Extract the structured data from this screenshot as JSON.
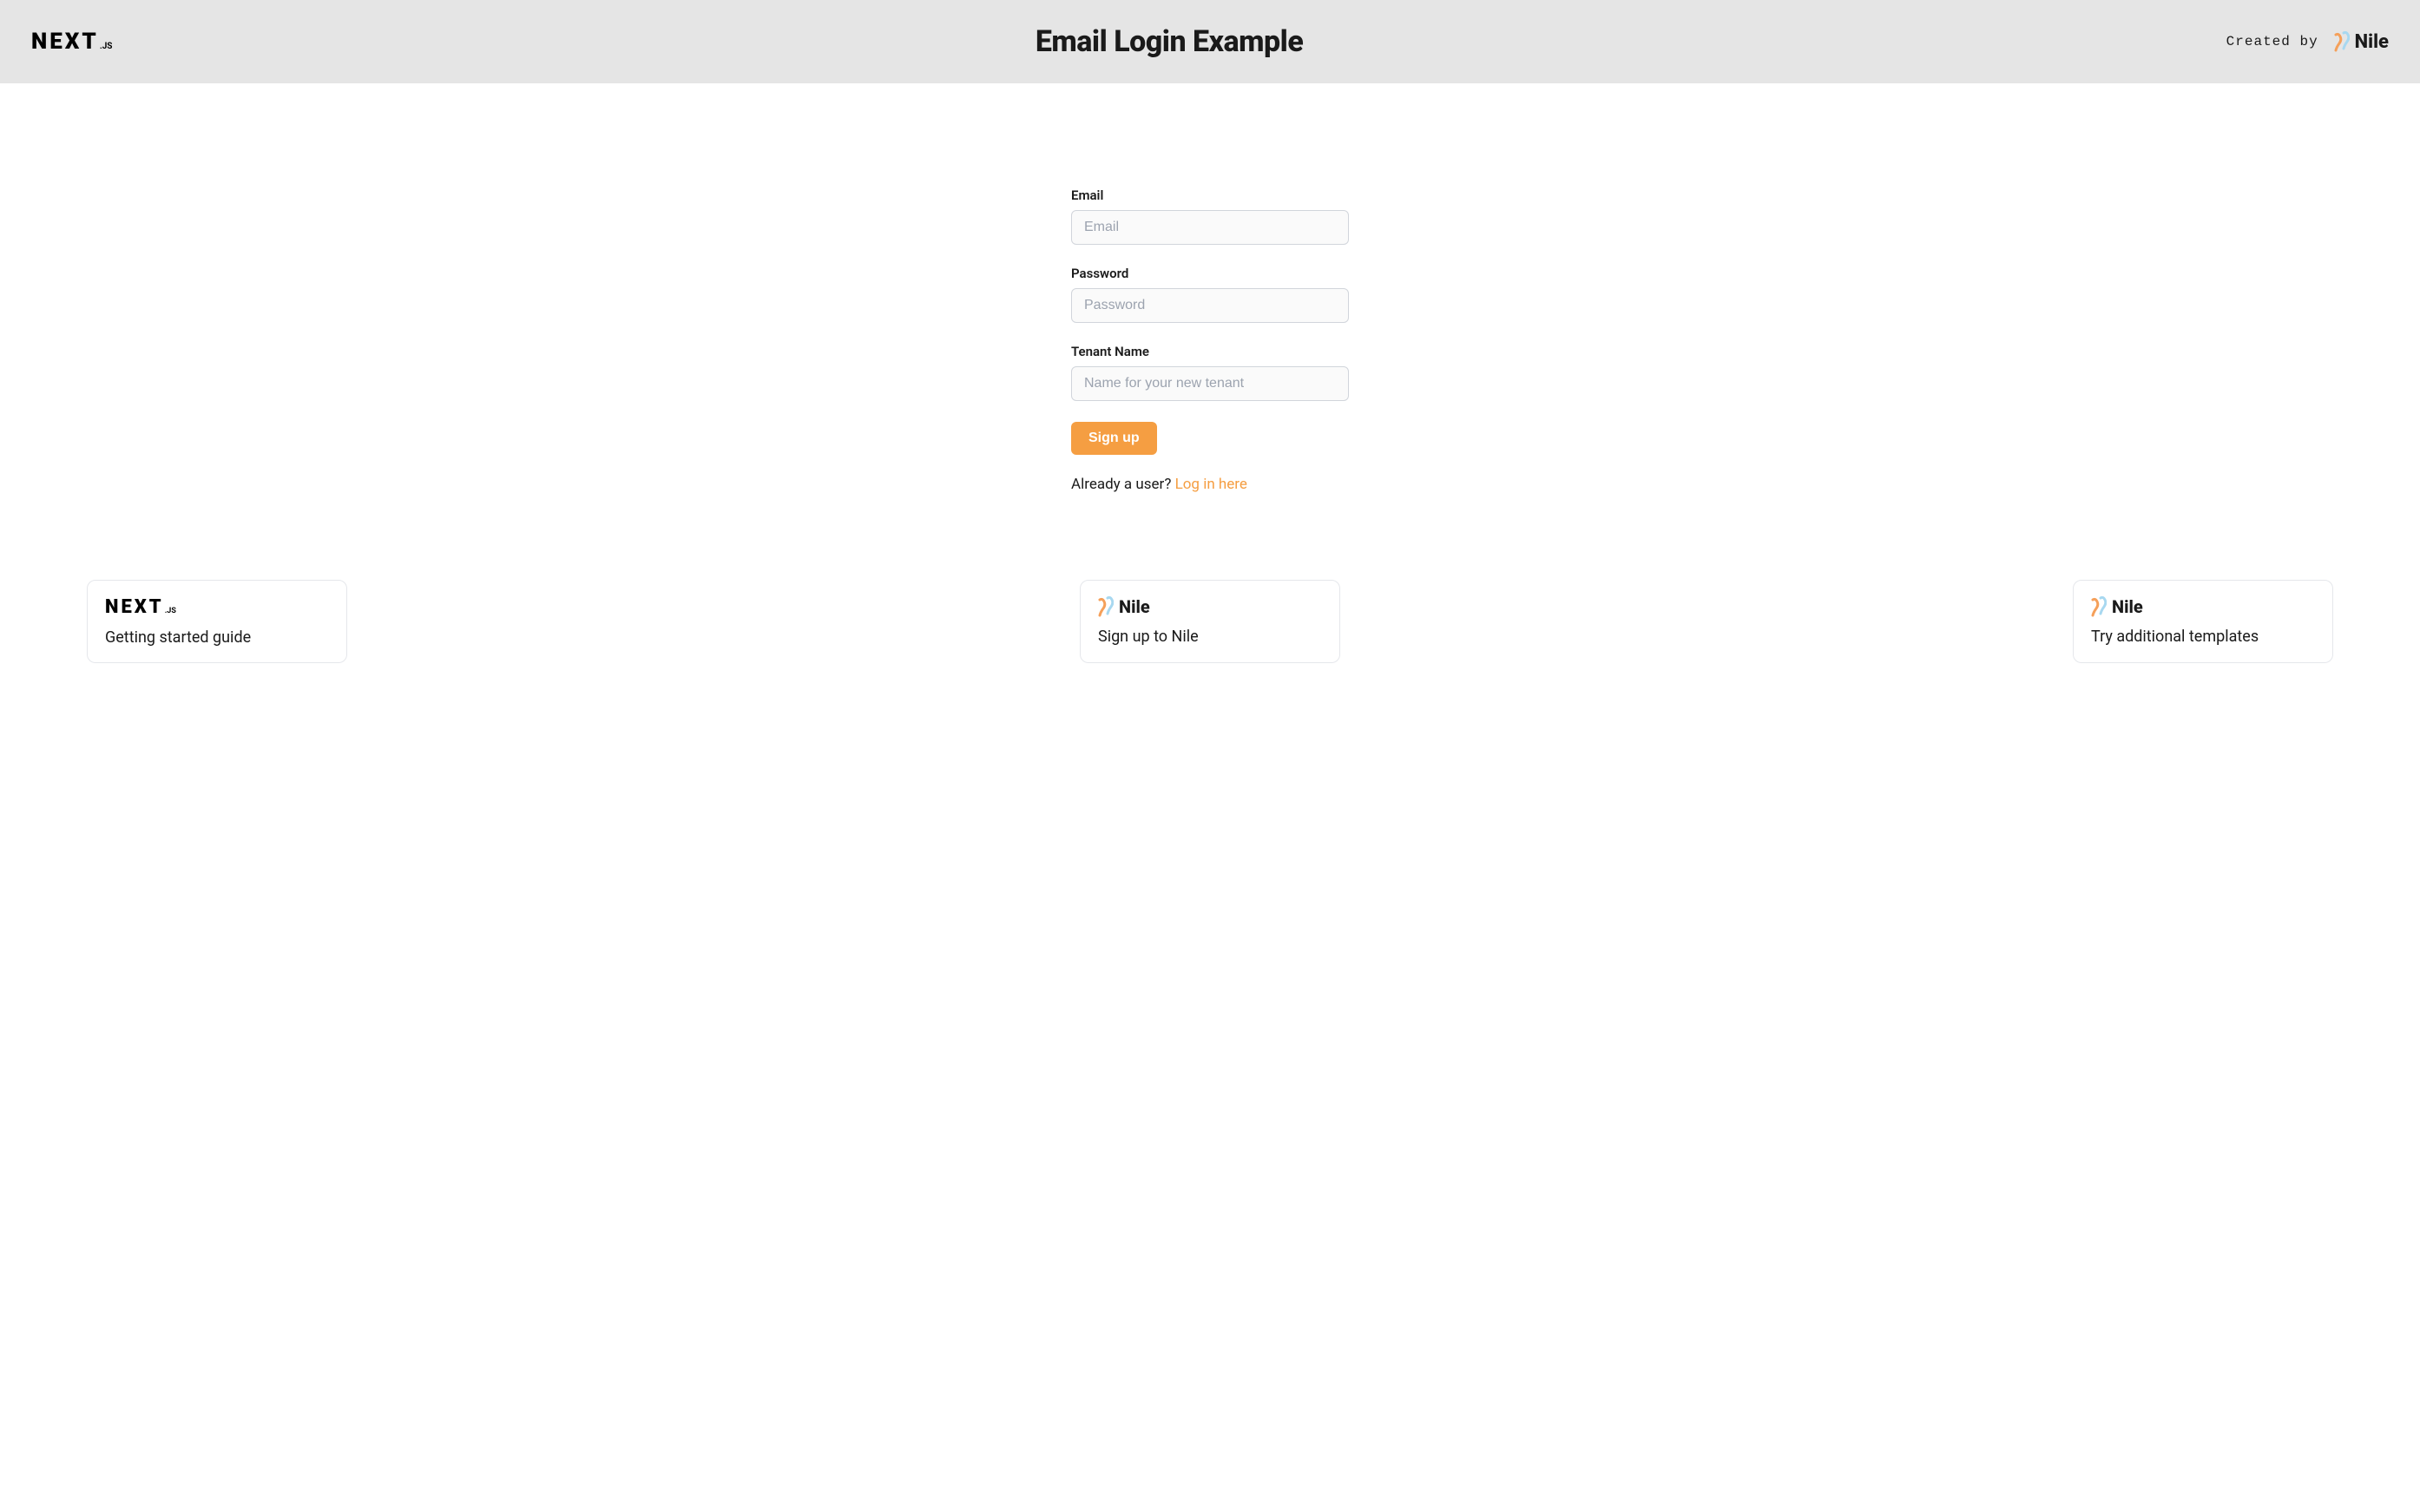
{
  "header": {
    "nextjs_main": "NEXT",
    "nextjs_suffix": ".JS",
    "title": "Email Login Example",
    "created_by": "Created by",
    "nile_text": "Nile"
  },
  "form": {
    "email": {
      "label": "Email",
      "placeholder": "Email",
      "value": ""
    },
    "password": {
      "label": "Password",
      "placeholder": "Password",
      "value": ""
    },
    "tenant": {
      "label": "Tenant Name",
      "placeholder": "Name for your new tenant",
      "value": ""
    },
    "signup_button": "Sign up",
    "already_user": "Already a user? ",
    "login_link": "Log in here"
  },
  "cards": [
    {
      "logo": "nextjs",
      "label": "Getting started guide"
    },
    {
      "logo": "nile",
      "label": "Sign up to Nile"
    },
    {
      "logo": "nile",
      "label": "Try additional templates"
    }
  ]
}
